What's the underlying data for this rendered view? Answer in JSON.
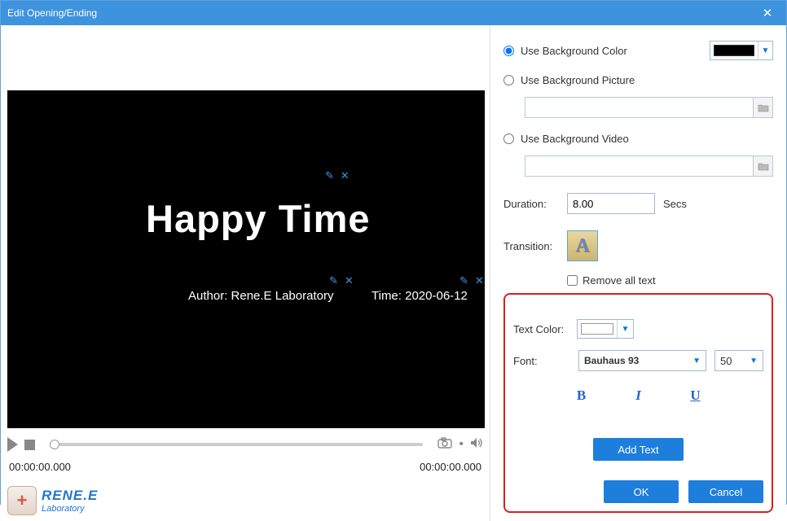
{
  "window": {
    "title": "Edit Opening/Ending"
  },
  "preview": {
    "main_title": "Happy Time",
    "author_line": "Author: Rene.E Laboratory",
    "time_line": "Time: 2020-06-12"
  },
  "player": {
    "time_left": "00:00:00.000",
    "time_right": "00:00:00.000"
  },
  "brand": {
    "line1": "RENE.E",
    "line2": "Laboratory"
  },
  "options": {
    "bg_color_label": "Use Background Color",
    "bg_picture_label": "Use Background Picture",
    "bg_video_label": "Use Background Video",
    "bg_picture_path": "",
    "bg_video_path": "",
    "duration_label": "Duration:",
    "duration_value": "8.00",
    "duration_unit": "Secs",
    "transition_label": "Transition:",
    "remove_text_label": "Remove all text",
    "bg_selected": "color",
    "bg_color_value": "#000000"
  },
  "textpanel": {
    "text_color_label": "Text Color:",
    "text_color_value": "#FFFFFF",
    "font_label": "Font:",
    "font_name": "Bauhaus 93",
    "font_size": "50",
    "bold": "B",
    "italic": "I",
    "underline": "U",
    "add_text_label": "Add Text",
    "ok_label": "OK",
    "cancel_label": "Cancel"
  }
}
